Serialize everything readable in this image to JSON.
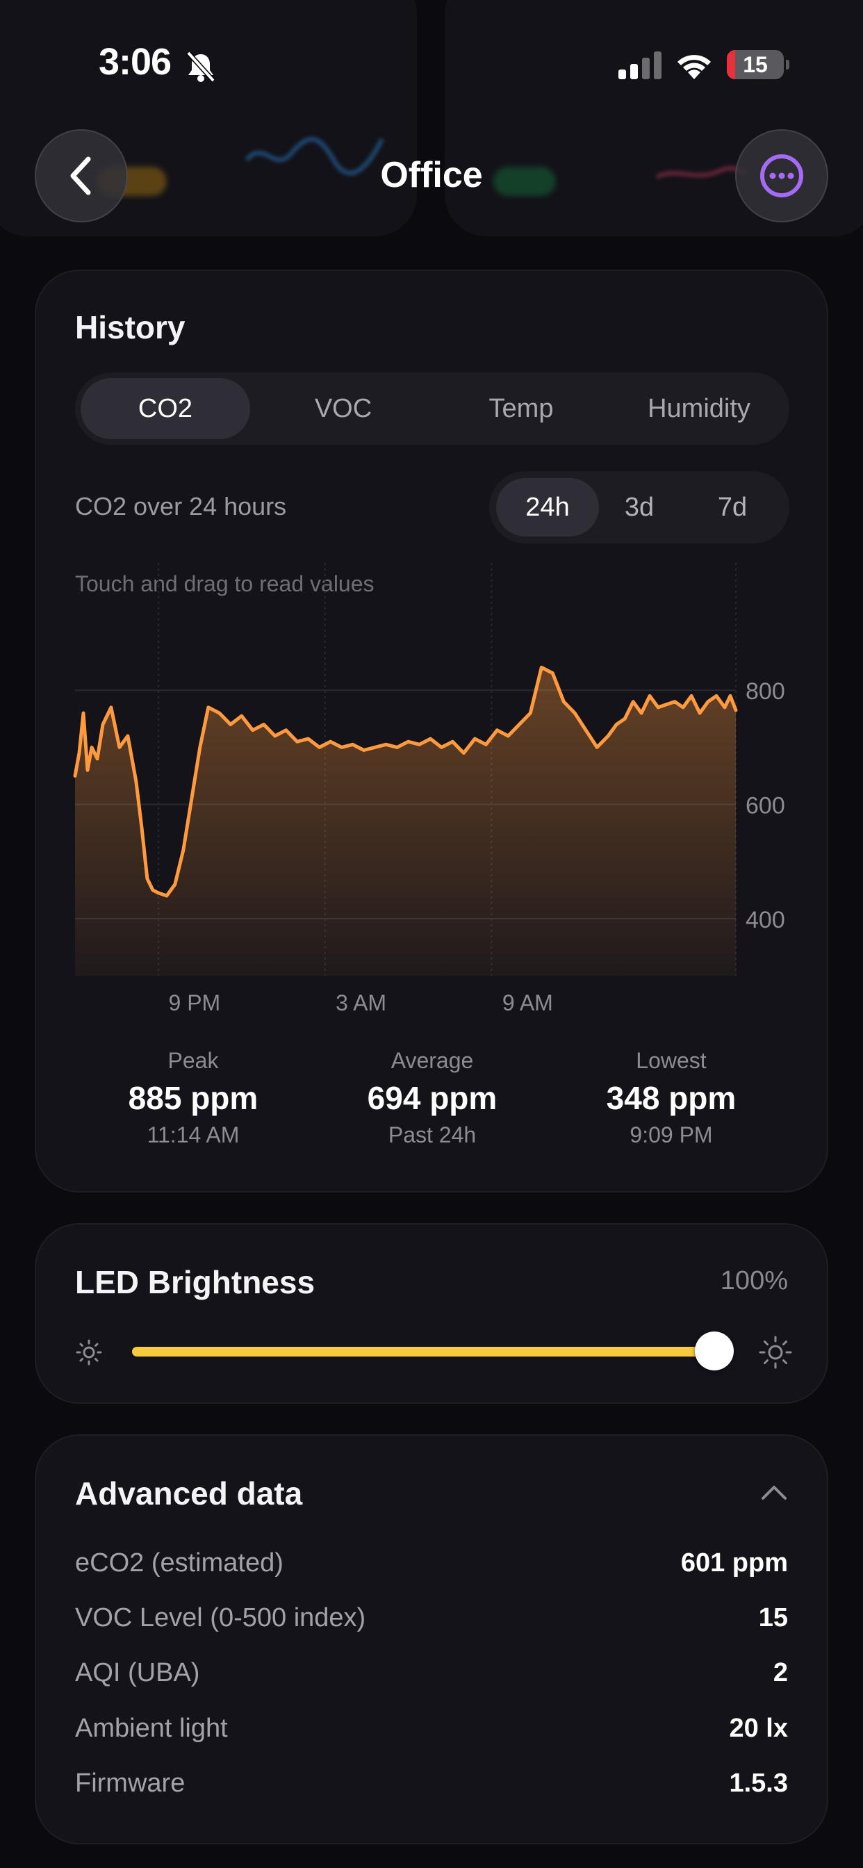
{
  "status_bar": {
    "time": "3:06",
    "battery": "15",
    "battery_fraction": 0.15
  },
  "header": {
    "title": "Office"
  },
  "history": {
    "title": "History",
    "metric_tabs": [
      "CO2",
      "VOC",
      "Temp",
      "Humidity"
    ],
    "active_metric": "CO2",
    "subtitle": "CO2 over 24 hours",
    "range_tabs": [
      "24h",
      "3d",
      "7d"
    ],
    "active_range": "24h",
    "hint": "Touch and drag to read values",
    "stats": [
      {
        "label": "Peak",
        "value": "885 ppm",
        "sub": "11:14 AM"
      },
      {
        "label": "Average",
        "value": "694 ppm",
        "sub": "Past 24h"
      },
      {
        "label": "Lowest",
        "value": "348 ppm",
        "sub": "9:09 PM"
      }
    ]
  },
  "chart_data": {
    "type": "area",
    "unit": "ppm",
    "ylim": [
      300,
      950
    ],
    "y_ticks": [
      "800",
      "600",
      "400"
    ],
    "y_tick_values": [
      800,
      600,
      400
    ],
    "x_ticks": [
      "9 PM",
      "3 AM",
      "9 AM"
    ],
    "x_tick_hours": [
      3,
      9,
      15
    ],
    "x_range_hours": [
      0,
      23.8
    ],
    "grid": true,
    "color": "#ff9a3e",
    "series": [
      {
        "x": [
          0.0,
          0.15,
          0.3,
          0.45,
          0.6,
          0.8,
          1.0,
          1.3,
          1.6,
          1.9,
          2.2,
          2.4,
          2.6,
          2.8,
          3.0,
          3.3,
          3.6,
          3.9,
          4.2,
          4.5,
          4.8,
          5.2,
          5.6,
          6.0,
          6.4,
          6.8,
          7.2,
          7.6,
          8.0,
          8.4,
          8.8,
          9.2,
          9.6,
          10.0,
          10.4,
          10.8,
          11.2,
          11.6,
          12.0,
          12.4,
          12.8,
          13.2,
          13.6,
          14.0,
          14.4,
          14.8,
          15.2,
          15.6,
          16.0,
          16.4,
          16.8,
          17.2,
          17.6,
          18.0,
          18.4,
          18.8,
          19.2,
          19.5,
          19.8,
          20.1,
          20.4,
          20.7,
          21.0,
          21.3,
          21.6,
          21.9,
          22.2,
          22.5,
          22.8,
          23.1,
          23.4,
          23.6,
          23.8
        ],
        "values": [
          650,
          690,
          760,
          660,
          700,
          680,
          740,
          770,
          700,
          720,
          640,
          560,
          470,
          450,
          445,
          440,
          460,
          520,
          610,
          700,
          770,
          760,
          740,
          755,
          730,
          740,
          720,
          730,
          710,
          715,
          700,
          710,
          700,
          705,
          695,
          700,
          705,
          700,
          710,
          705,
          715,
          700,
          710,
          690,
          715,
          705,
          730,
          720,
          740,
          760,
          840,
          830,
          780,
          760,
          730,
          700,
          720,
          740,
          750,
          780,
          760,
          790,
          770,
          775,
          780,
          770,
          790,
          760,
          780,
          790,
          770,
          790,
          765
        ]
      }
    ]
  },
  "led": {
    "title": "LED Brightness",
    "percent": "100%",
    "level": 1.0
  },
  "advanced": {
    "title": "Advanced data",
    "rows": [
      {
        "key": "eCO2 (estimated)",
        "value": "601 ppm"
      },
      {
        "key": "VOC Level (0-500 index)",
        "value": "15"
      },
      {
        "key": "AQI (UBA)",
        "value": "2"
      },
      {
        "key": "Ambient light",
        "value": "20 lx"
      },
      {
        "key": "Firmware",
        "value": "1.5.3"
      }
    ]
  },
  "colors": {
    "accent_orange": "#ff9a3e",
    "accent_yellow": "#f7cb3d",
    "accent_purple": "#a46cf5",
    "card_bg": "#141319"
  },
  "icons": {
    "back": "chevron-left-icon",
    "more": "ellipsis-circle-icon",
    "collapse": "chevron-up-icon",
    "sun_low": "sun-low-icon",
    "sun_high": "sun-high-icon"
  }
}
